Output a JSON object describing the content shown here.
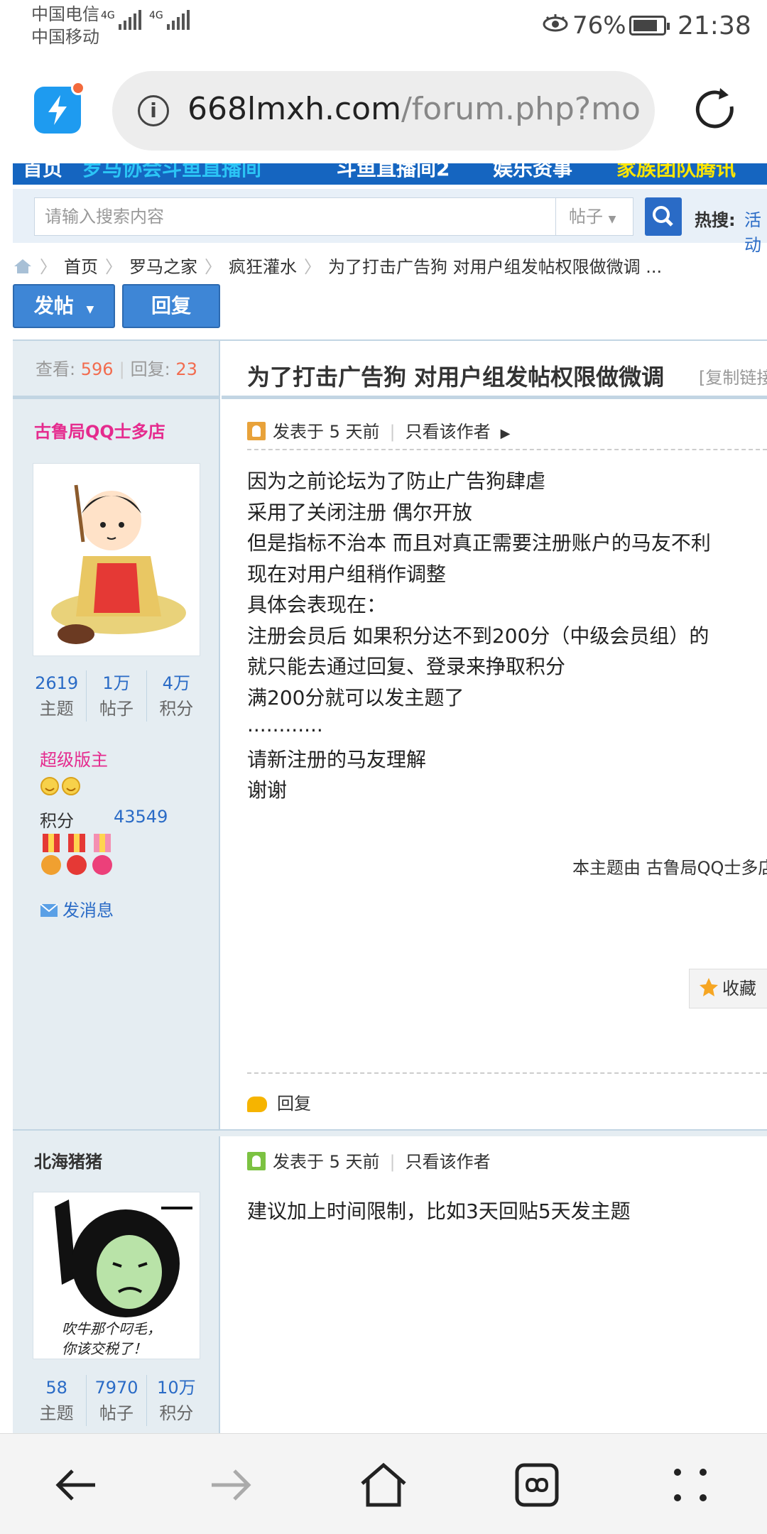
{
  "status_bar": {
    "carrier1": "中国电信",
    "carrier2": "中国移动",
    "net1": "4G",
    "net2": "4G",
    "battery": "76%",
    "time": "21:38"
  },
  "browser": {
    "url_host": "668lmxh.com",
    "url_path": "/forum.php?mod"
  },
  "forum_nav": [
    "首页",
    "罗马协会斗鱼直播间",
    "斗鱼直播间2",
    "娱乐资事",
    "家族团队腾讯"
  ],
  "search": {
    "placeholder": "请输入搜索内容",
    "type": "帖子",
    "hot_label": "热搜:",
    "hot_item": "活动"
  },
  "breadcrumb": [
    "首页",
    "罗马之家",
    "疯狂灌水",
    "为了打击广告狗 对用户组发帖权限做微调 ..."
  ],
  "actions": {
    "post": "发帖",
    "reply": "回复"
  },
  "thread": {
    "views_label": "查看:",
    "views": "596",
    "replies_label": "回复:",
    "replies": "23",
    "title": "为了打击广告狗 对用户组发帖权限做微调",
    "copy_link": "[复制链接]"
  },
  "posts": [
    {
      "author": "古鲁局QQ士多店",
      "stats": [
        {
          "value": "2619",
          "label": "主题"
        },
        {
          "value": "1万",
          "label": "帖子"
        },
        {
          "value": "4万",
          "label": "积分"
        }
      ],
      "group": "超级版主",
      "points_label": "积分",
      "points": "43549",
      "send_msg": "发消息",
      "meta_time": "发表于 5 天前",
      "meta_author_only": "只看该作者",
      "body": [
        "因为之前论坛为了防止广告狗肆虐",
        "采用了关闭注册 偶尔开放",
        "但是指标不治本 而且对真正需要注册账户的马友不利",
        "现在对用户组稍作调整",
        "具体会表现在：",
        "注册会员后 如果积分达不到200分（中级会员组）的",
        "就只能去通过回复、登录来挣取积分",
        "满200分就可以发主题了",
        "............",
        "请新注册的马友理解",
        "谢谢"
      ],
      "footer_note": "本主题由 古鲁局QQ士多店",
      "collect": "收藏",
      "reply": "回复"
    },
    {
      "author": "北海猪猪",
      "stats": [
        {
          "value": "58",
          "label": "主题"
        },
        {
          "value": "7970",
          "label": "帖子"
        },
        {
          "value": "10万",
          "label": "积分"
        }
      ],
      "avatar_caption1": "吹牛那个叼毛，",
      "avatar_caption2": "你该交税了！",
      "meta_time": "发表于 5 天前",
      "meta_author_only": "只看该作者",
      "body": [
        "建议加上时间限制，比如3天回贴5天发主题"
      ]
    }
  ],
  "colors": {
    "accent": "#2A6BC6",
    "author_name": "#E52B8E",
    "count_orange": "#F26C4F",
    "nav_blue": "#1565C0"
  }
}
